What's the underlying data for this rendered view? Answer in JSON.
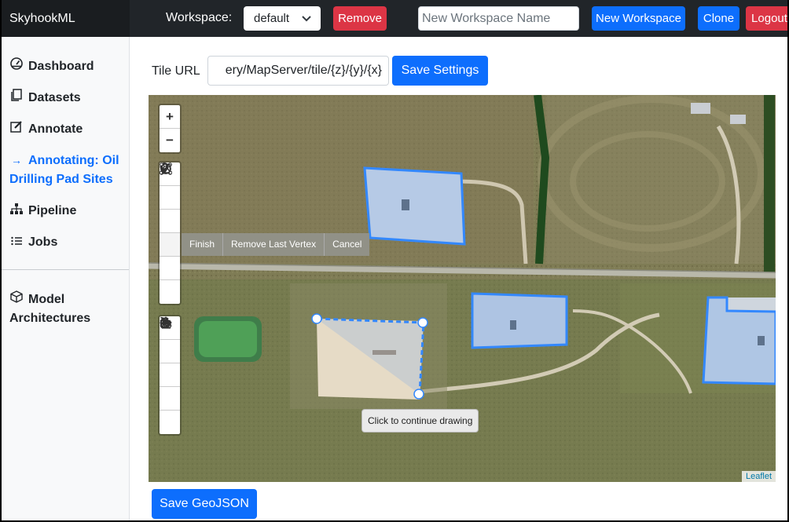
{
  "navbar": {
    "brand": "SkyhookML",
    "workspace_label": "Workspace:",
    "workspace_selected": "default",
    "remove_label": "Remove",
    "new_workspace_placeholder": "New Workspace Name",
    "new_workspace_label": "New Workspace",
    "clone_label": "Clone",
    "logout_label": "Logout"
  },
  "sidebar": {
    "items": [
      {
        "label": "Dashboard",
        "icon": "gauge-icon"
      },
      {
        "label": "Datasets",
        "icon": "copy-icon"
      },
      {
        "label": "Annotate",
        "icon": "edit-icon"
      },
      {
        "label_line1": "Annotating: Oil",
        "label_line2": "Drilling Pad Sites",
        "icon": "arrow-right-icon"
      },
      {
        "label": "Pipeline",
        "icon": "diagram-icon"
      },
      {
        "label": "Jobs",
        "icon": "list-icon"
      },
      {
        "label_line1": "Model",
        "label_line2": "Architectures",
        "icon": "box-icon"
      }
    ],
    "active_color": "#0d6efd"
  },
  "main": {
    "tile_url_label": "Tile URL",
    "tile_url_value": "ery/MapServer/tile/{z}/{y}/{x}",
    "save_settings_label": "Save Settings",
    "save_geojson_label": "Save GeoJSON"
  },
  "map": {
    "zoom_in": "+",
    "zoom_out": "−",
    "draw_actions": [
      "Finish",
      "Remove Last Vertex",
      "Cancel"
    ],
    "tooltip": "Click to continue drawing",
    "attribution": "Leaflet",
    "polygon_color": "#3388ff"
  },
  "colors": {
    "navbar_bg": "#212529",
    "danger": "#dc3545",
    "primary": "#0d6efd"
  }
}
